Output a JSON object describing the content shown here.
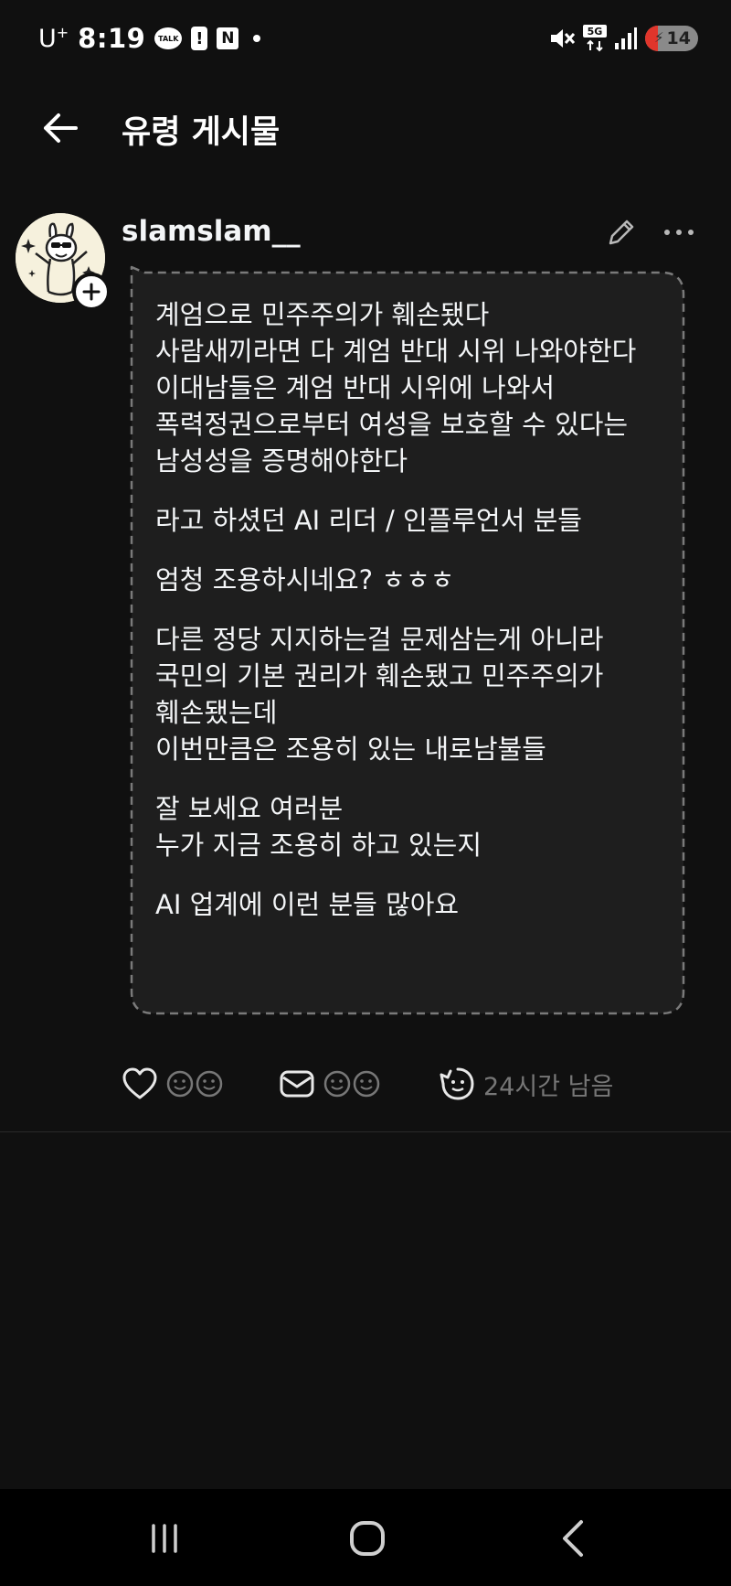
{
  "status_bar": {
    "carrier": "U",
    "carrier_sup": "+",
    "time": "8:19",
    "talk_icon_text": "TALK",
    "alert_icon_text": "!",
    "n_icon_text": "N",
    "network": "5G",
    "battery_level": "14"
  },
  "header": {
    "title": "유령 게시물"
  },
  "post": {
    "username": "slamslam__",
    "paragraphs": [
      "계엄으로 민주주의가 훼손됐다\n사람새끼라면 다 계엄 반대 시위 나와야한다\n이대남들은 계엄 반대 시위에 나와서\n폭력정권으로부터 여성을 보호할 수 있다는\n남성성을 증명해야한다",
      "라고 하셨던 AI 리더 / 인플루언서 분들",
      "엄청 조용하시네요? ㅎㅎㅎ",
      "다른 정당 지지하는걸 문제삼는게 아니라\n국민의 기본 권리가 훼손됐고 민주주의가\n훼손됐는데\n이번만큼은 조용히 있는 내로남불들",
      "잘 보세요 여러분\n누가 지금 조용히 하고 있는지",
      "AI 업계에 이런 분들 많아요"
    ],
    "actions": {
      "time_remaining": "24시간 남음"
    }
  },
  "icons": {
    "back": "arrow-left-icon",
    "edit": "pencil-icon",
    "more": "more-horizontal-icon",
    "like": "heart-icon",
    "reply": "envelope-icon",
    "timer": "ghost-timer-icon",
    "follow": "plus-icon"
  },
  "colors": {
    "background": "#101010",
    "bubble": "#1e1e1e",
    "bubble_border": "#7a7a7a",
    "text": "#f3f5f7",
    "muted": "#777777",
    "battery_low": "#e0352b"
  }
}
